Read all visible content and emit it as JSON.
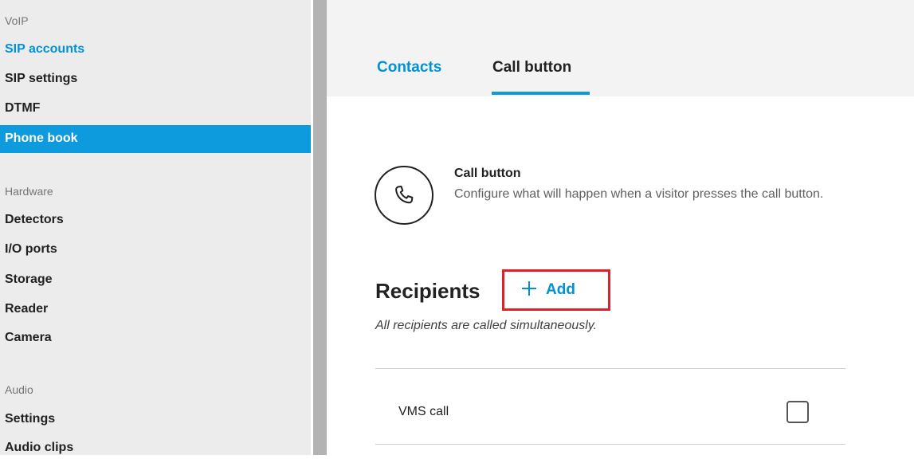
{
  "sidebar": {
    "groups": {
      "voip": "VoIP",
      "hardware": "Hardware",
      "audio": "Audio"
    },
    "items": {
      "sip_accounts": "SIP accounts",
      "sip_settings": "SIP settings",
      "dtmf": "DTMF",
      "phone_book": "Phone book",
      "detectors": "Detectors",
      "io_ports": "I/O ports",
      "storage": "Storage",
      "reader": "Reader",
      "camera": "Camera",
      "settings": "Settings",
      "audio_clips": "Audio clips"
    }
  },
  "tabs": {
    "contacts": "Contacts",
    "call_button": "Call button"
  },
  "call_section": {
    "icon": "phone-icon",
    "title": "Call button",
    "description": "Configure what will happen when a visitor presses the call button."
  },
  "recipients": {
    "title": "Recipients",
    "add_label": "Add",
    "add_icon": "plus-icon",
    "note": "All recipients are called simultaneously.",
    "rows": [
      {
        "label": "VMS call",
        "checked": false
      }
    ]
  },
  "colors": {
    "accent": "#0e9bde",
    "link": "#0092d4",
    "highlight": "#e0202b"
  }
}
